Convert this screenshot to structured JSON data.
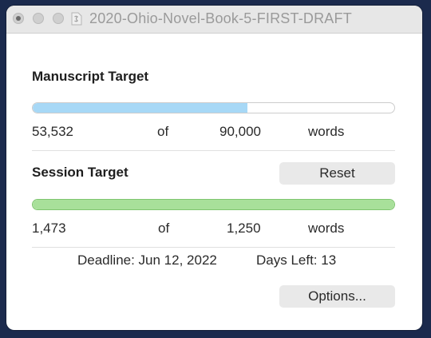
{
  "window": {
    "title": "2020-Ohio-Novel-Book-5-FIRST-DRAFT"
  },
  "manuscript": {
    "heading": "Manuscript Target",
    "current": "53,532",
    "of_label": "of",
    "target": "90,000",
    "unit": "words",
    "progress_fraction": 0.5948,
    "bar_color": "#a7d8f6",
    "track_color": "#ffffff"
  },
  "session": {
    "heading": "Session Target",
    "reset_label": "Reset",
    "current": "1,473",
    "of_label": "of",
    "target": "1,250",
    "unit": "words",
    "progress_fraction": 1.0,
    "bar_color": "#a8e09a",
    "bar_border": "#7fc56f"
  },
  "footer": {
    "deadline": "Deadline: Jun 12, 2022",
    "days_left": "Days Left: 13",
    "options_label": "Options..."
  }
}
